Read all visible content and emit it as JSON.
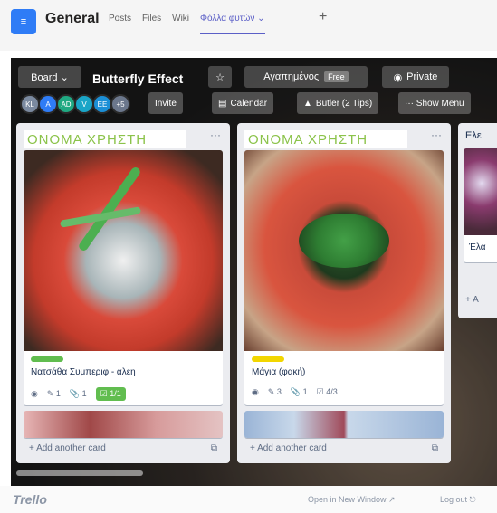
{
  "teams": {
    "team_icon": "≡",
    "channel": "General",
    "tabs": [
      "Posts",
      "Files",
      "Wiki",
      "Φόλλα φυτών ⌄"
    ],
    "add_tab": "+"
  },
  "board": {
    "board_label": "Board ⌄",
    "title": "Butterfly Effect",
    "star": "☆",
    "workspace_label": "Αγαπημένος",
    "workspace_badge": "Free",
    "visibility": "Private",
    "invite": "Invite",
    "calendar": "Calendar",
    "butler": "Butler (2 Tips)",
    "show_menu": "··· Show Menu",
    "members": [
      {
        "initials": "KL",
        "color": "#7b8aa0"
      },
      {
        "initials": "A",
        "color": "#2f7cf6"
      },
      {
        "initials": "AD",
        "color": "#20a982"
      },
      {
        "initials": "V",
        "color": "#1aa5c7"
      },
      {
        "initials": "EE",
        "color": "#1b8fd6"
      },
      {
        "initials": "+5",
        "color": "#6b778c"
      }
    ]
  },
  "lists": [
    {
      "title": "ΟΝΟΜΑ ΧΡΗΣΤΗ",
      "menu": "···",
      "card": {
        "label_color": "#61bd4f",
        "title": "Νατσάθα Συμπεριφ - αλεη",
        "badges": {
          "watch": "◉",
          "comments": "1",
          "attachments": "1",
          "checklist": "1/1"
        }
      },
      "add_card": "+ Add another card",
      "template_icon": "⧉"
    },
    {
      "title": "ΟΝΟΜΑ ΧΡΗΣΤΗ",
      "menu": "···",
      "card": {
        "label_color": "#f2d600",
        "title": "Μάγια (φακή)",
        "badges": {
          "watch": "◉",
          "comments": "3",
          "attachments": "1",
          "checklist": "4/3"
        }
      },
      "add_card": "+ Add another card",
      "template_icon": "⧉"
    },
    {
      "title": "Ελε",
      "partial_card_title": "Έλα",
      "add_card": "+ A"
    }
  ],
  "footer": {
    "logo": "Trello",
    "open_new_window": "Open in New Window ↗",
    "logout": "Log out ⎋"
  }
}
